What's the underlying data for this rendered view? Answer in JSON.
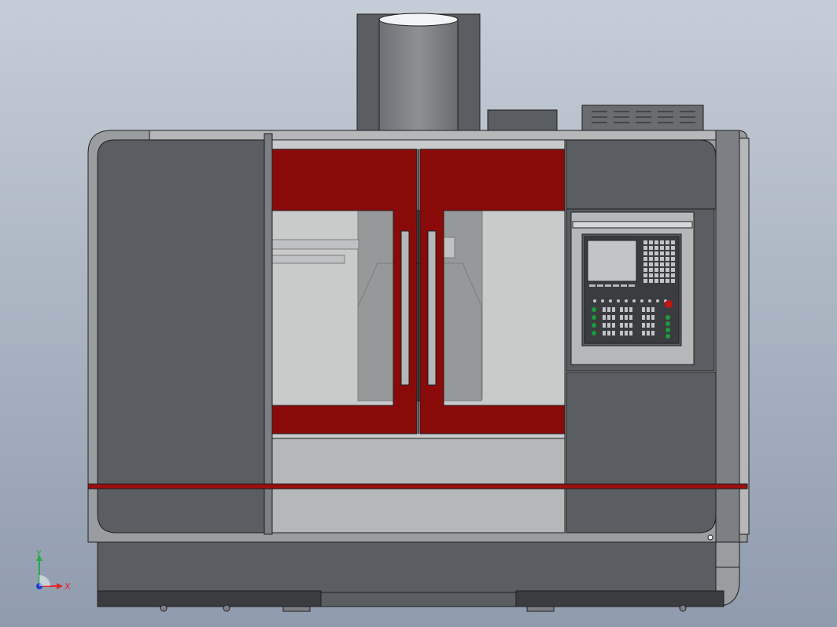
{
  "viewport": {
    "background_top": "#c5cdd6",
    "background_bottom": "#8f9cae"
  },
  "machine": {
    "colors": {
      "body_dark": "#5a5d61",
      "body_mid": "#7c8084",
      "body_light": "#9a9da0",
      "panel_gray": "#b5b7b9",
      "door_red": "#8a0a0a",
      "stripe_red": "#9b0f0f",
      "enclosure_inner": "#c9cacb",
      "screen": "#c2c4c6",
      "key_green": "#1c9b3c",
      "key_red": "#c41414",
      "outline": "#1d1e20"
    }
  },
  "triad": {
    "x_label": "X",
    "y_label": "Y",
    "x_color": "#e0262a",
    "y_color": "#2aa84a",
    "z_color": "#1f3fd1"
  }
}
